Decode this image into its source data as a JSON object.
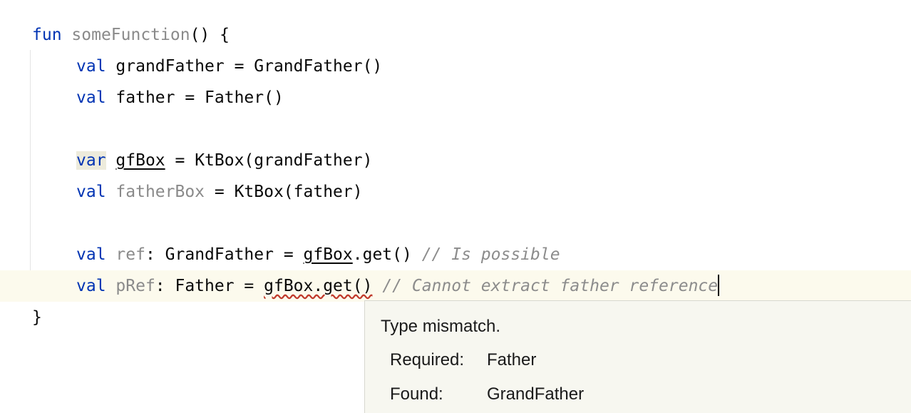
{
  "code": {
    "line1": {
      "kw": "fun",
      "name": "someFunction",
      "rest": "() {"
    },
    "line2": {
      "kw": "val",
      "rest": "grandFather = GrandFather()"
    },
    "line3": {
      "kw": "val",
      "rest": "father = Father()"
    },
    "line5": {
      "kw": "var",
      "name": "gfBox",
      "rest": " = KtBox(grandFather)"
    },
    "line6": {
      "kw": "val",
      "name": "fatherBox",
      "rest": " = KtBox(father)"
    },
    "line8": {
      "kw": "val",
      "name": "ref",
      "mid": ": GrandFather = ",
      "ref": "gfBox",
      "call": ".get() ",
      "comment": "// Is possible"
    },
    "line9": {
      "kw": "val",
      "name": "pRef",
      "mid": ": Father = ",
      "err": "gfBox.get()",
      "sp": " ",
      "comment": "// Cannot extract father reference"
    },
    "line10": {
      "rest": "}"
    }
  },
  "tooltip": {
    "title": "Type mismatch.",
    "required_label": "Required:",
    "required_value": "Father",
    "found_label": "Found:",
    "found_value": "GrandFather"
  }
}
